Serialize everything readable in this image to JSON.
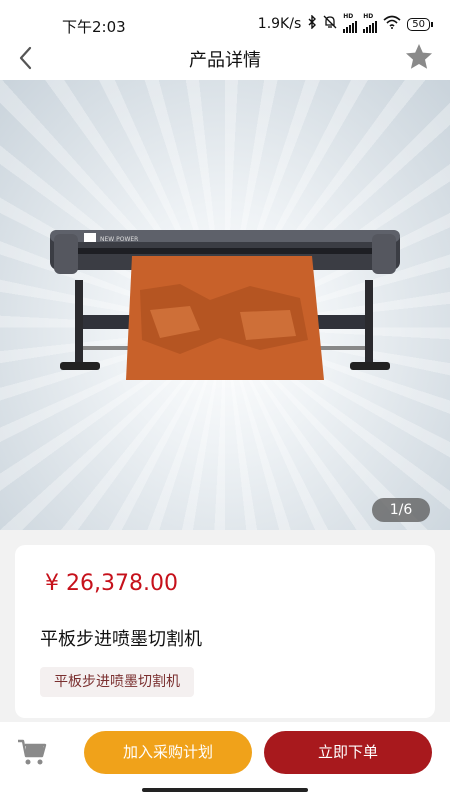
{
  "status_bar": {
    "time": "下午2:03",
    "net_speed": "1.9K/s",
    "battery": "50",
    "icons": [
      "bluetooth-icon",
      "mute-icon",
      "hd-signal-icon",
      "hd-signal-icon",
      "wifi-icon",
      "battery-icon"
    ]
  },
  "nav": {
    "title": "产品详情",
    "back_icon": "chevron-left-icon",
    "favorite_icon": "star-icon"
  },
  "gallery": {
    "page_indicator": "1/6",
    "image_description_icon": "plotter-cutter-image"
  },
  "product": {
    "price": "¥ 26,378.00",
    "name": "平板步进喷墨切割机",
    "tag": "平板步进喷墨切割机"
  },
  "bottom_bar": {
    "cart_icon": "cart-icon",
    "add_plan_label": "加入采购计划",
    "buy_now_label": "立即下单"
  },
  "colors": {
    "price_red": "#c6111b",
    "add_plan_orange": "#f0a21a",
    "buy_now_red": "#a8191d",
    "tag_bg": "#f4f0f0"
  }
}
